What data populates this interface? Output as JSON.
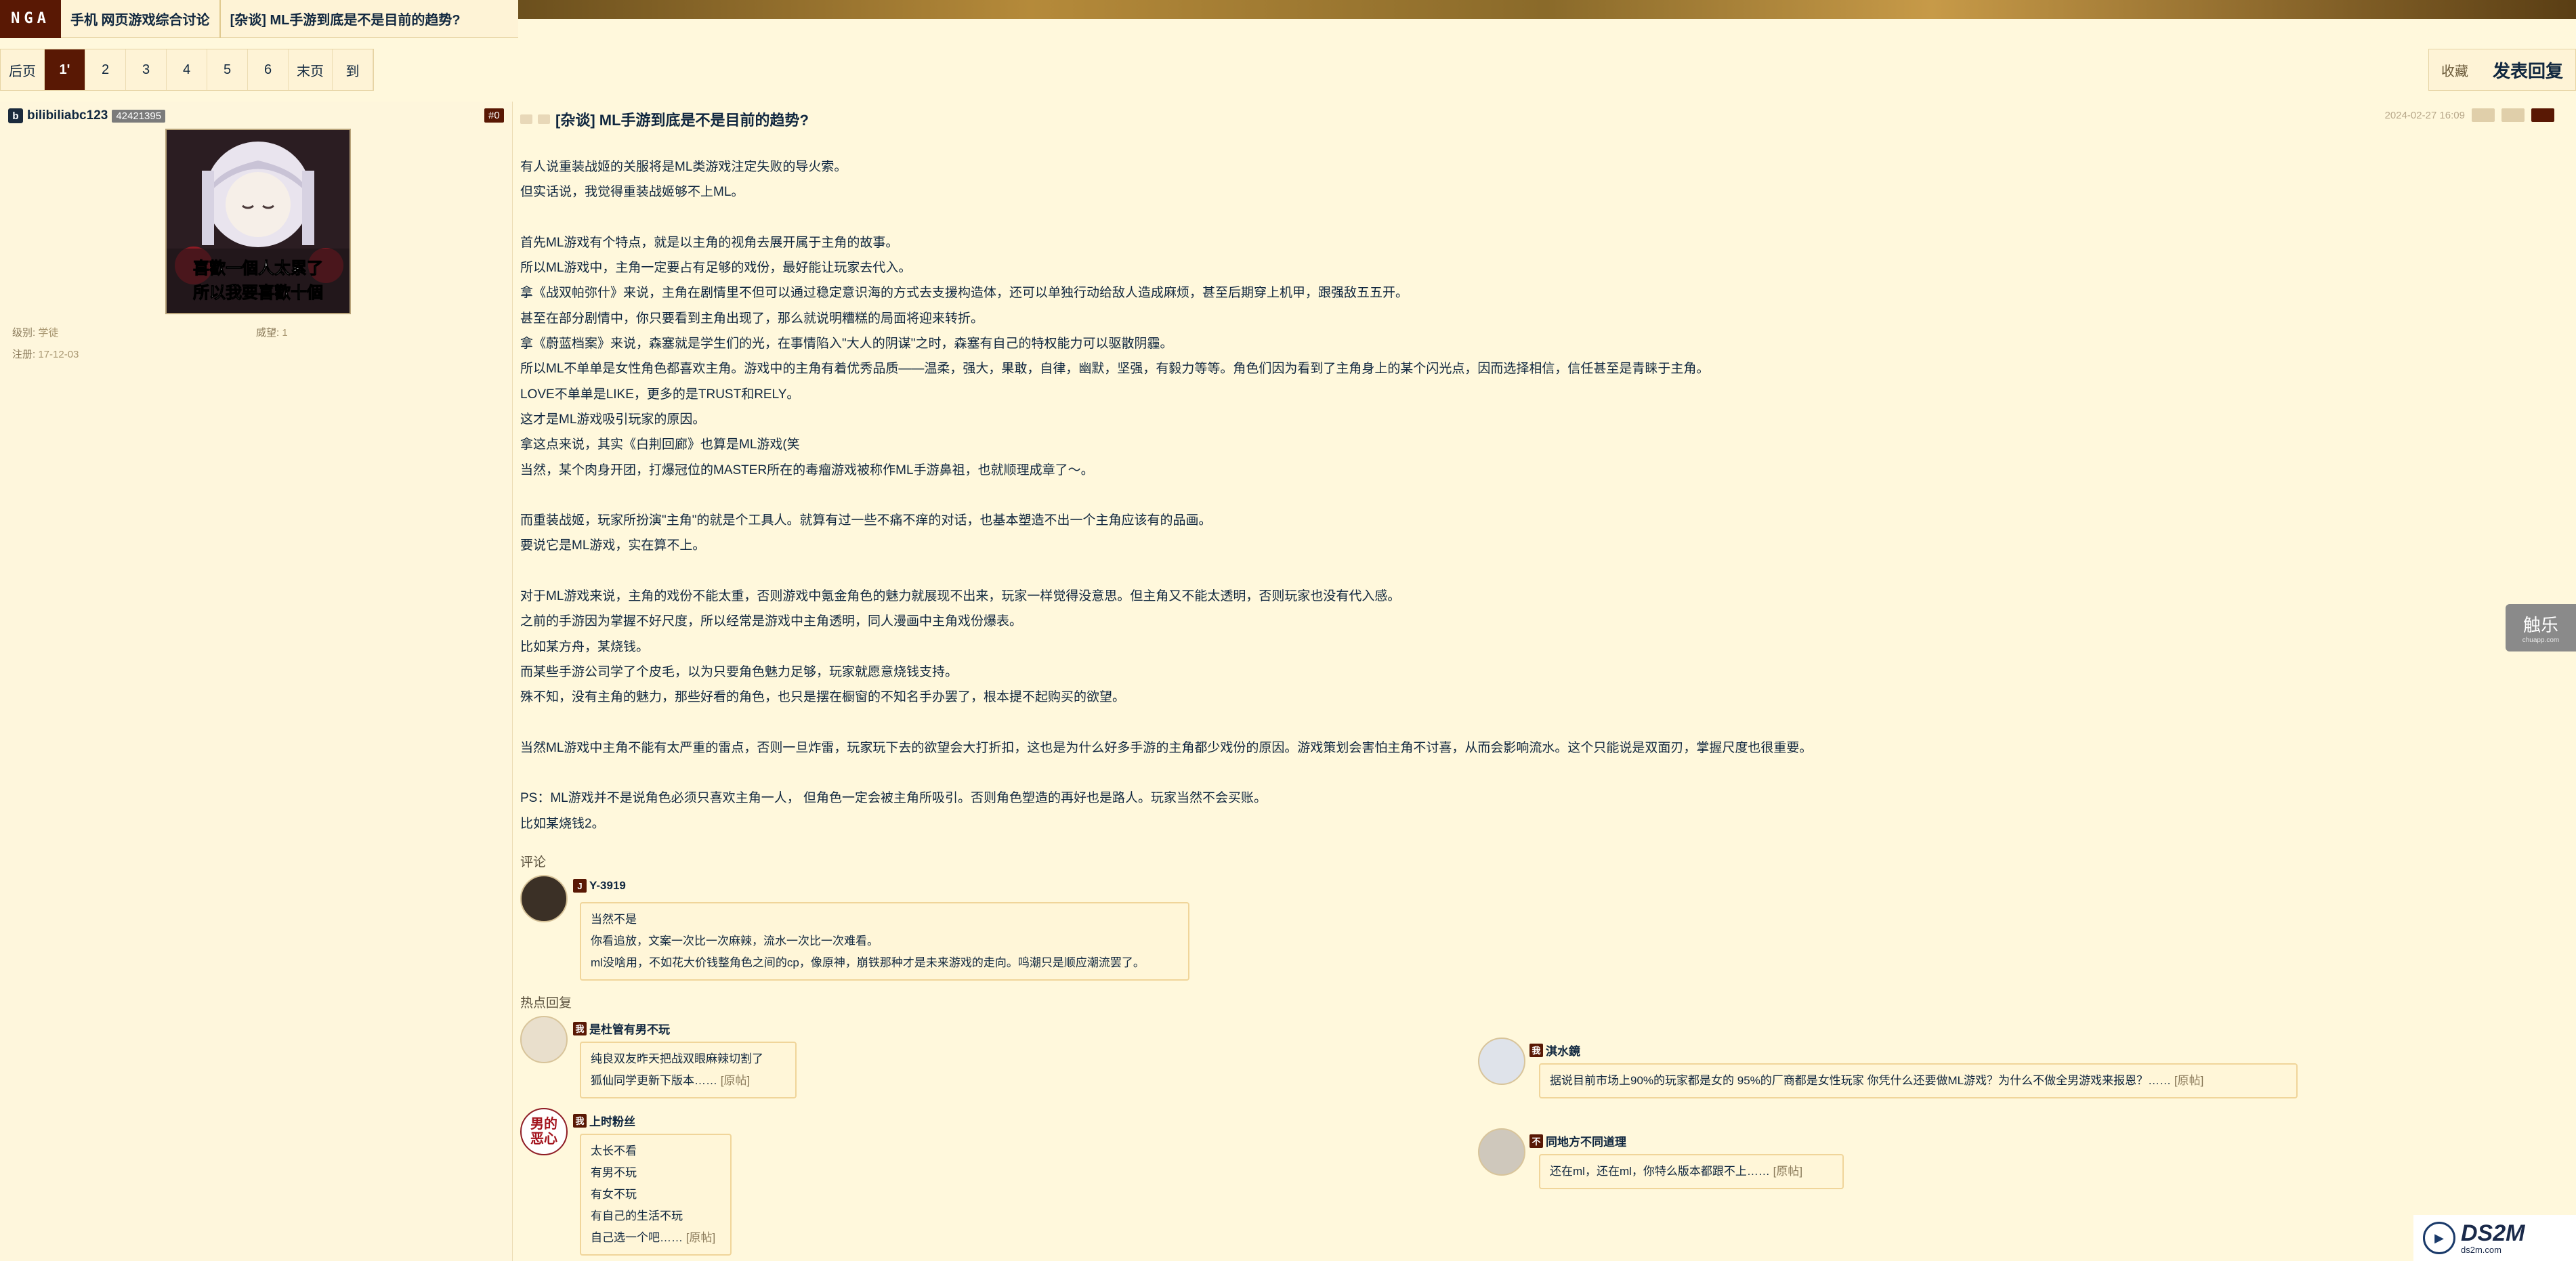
{
  "header": {
    "logo": "NGA",
    "crumbs": [
      "手机 网页游戏综合讨论",
      "[杂谈] ML手游到底是不是目前的趋势?"
    ]
  },
  "pager": {
    "items": [
      "后页",
      "1'",
      "2",
      "3",
      "4",
      "5",
      "6",
      "末页",
      "到"
    ],
    "active_index": 1
  },
  "actions": {
    "favorite": "收藏",
    "reply": "发表回复"
  },
  "user": {
    "name": "bilibiliabc123",
    "badge": "b",
    "uid": "42421395",
    "floor": "#0",
    "level_label": "级别:",
    "level": "学徒",
    "prestige_label": "威望:",
    "prestige": "1",
    "reg_label": "注册:",
    "reg": "17-12-03",
    "avatar_text_1": "喜歡一個人太累了",
    "avatar_text_2": "所以我要喜歡十個"
  },
  "post": {
    "title": "[杂谈] ML手游到底是不是目前的趋势?",
    "date": "2024-02-27 16:09",
    "lines": [
      "有人说重装战姬的关服将是ML类游戏注定失败的导火索。",
      "但实话说，我觉得重装战姬够不上ML。",
      "",
      "首先ML游戏有个特点，就是以主角的视角去展开属于主角的故事。",
      "所以ML游戏中，主角一定要占有足够的戏份，最好能让玩家去代入。",
      "拿《战双帕弥什》来说，主角在剧情里不但可以通过稳定意识海的方式去支援构造体，还可以单独行动给敌人造成麻烦，甚至后期穿上机甲，跟强敌五五开。",
      "甚至在部分剧情中，你只要看到主角出现了，那么就说明糟糕的局面将迎来转折。",
      "拿《蔚蓝档案》来说，森塞就是学生们的光，在事情陷入\"大人的阴谋\"之时，森塞有自己的特权能力可以驱散阴霾。",
      "所以ML不单单是女性角色都喜欢主角。游戏中的主角有着优秀品质——温柔，强大，果敢，自律，幽默，坚强，有毅力等等。角色们因为看到了主角身上的某个闪光点，因而选择相信，信任甚至是青睐于主角。",
      "LOVE不单单是LIKE，更多的是TRUST和RELY。",
      "这才是ML游戏吸引玩家的原因。",
      "拿这点来说，其实《白荆回廊》也算是ML游戏(笑",
      "当然，某个肉身开团，打爆冠位的MASTER所在的毒瘤游戏被称作ML手游鼻祖，也就顺理成章了～。",
      "",
      "而重装战姬，玩家所扮演\"主角\"的就是个工具人。就算有过一些不痛不痒的对话，也基本塑造不出一个主角应该有的品画。",
      "要说它是ML游戏，实在算不上。",
      "",
      "对于ML游戏来说，主角的戏份不能太重，否则游戏中氪金角色的魅力就展现不出来，玩家一样觉得没意思。但主角又不能太透明，否则玩家也没有代入感。",
      "之前的手游因为掌握不好尺度，所以经常是游戏中主角透明，同人漫画中主角戏份爆表。",
      "比如某方舟，某烧钱。",
      "而某些手游公司学了个皮毛，以为只要角色魅力足够，玩家就愿意烧钱支持。",
      "殊不知，没有主角的魅力，那些好看的角色，也只是摆在橱窗的不知名手办罢了，根本提不起购买的欲望。",
      "",
      "当然ML游戏中主角不能有太严重的雷点，否则一旦炸雷，玩家玩下去的欲望会大打折扣，这也是为什么好多手游的主角都少戏份的原因。游戏策划会害怕主角不讨喜，从而会影响流水。这个只能说是双面刃，掌握尺度也很重要。",
      "",
      "PS：ML游戏并不是说角色必须只喜欢主角一人，  但角色一定会被主角所吸引。否则角色塑造的再好也是路人。玩家当然不会买账。",
      "比如某烧钱2。"
    ]
  },
  "comments": {
    "label": "评论",
    "items": [
      {
        "name": "Y-3919",
        "tag": "J",
        "lines": [
          "当然不是",
          "你看追放，文案一次比一次麻辣，流水一次比一次难看。",
          "ml没啥用，不如花大价钱整角色之间的cp，像原神，崩铁那种才是未来游戏的走向。鸣潮只是顺应潮流罢了。"
        ]
      }
    ]
  },
  "hot": {
    "label": "热点回复",
    "source_label": "[原帖]",
    "left": [
      {
        "name": "是杜管有男不玩",
        "tag": "我",
        "lines": [
          "纯良双友昨天把战双眼麻辣切割了",
          "狐仙同学更新下版本……"
        ]
      },
      {
        "name": "上时粉丝",
        "tag": "我",
        "avatar_text_1": "男的",
        "avatar_text_2": "恶心",
        "lines": [
          "太长不看",
          "有男不玩",
          "有女不玩",
          "有自己的生活不玩",
          "自己选一个吧……"
        ]
      }
    ],
    "right": [
      {
        "name": "淇水鏡",
        "tag": "我",
        "lines": [
          "据说目前市场上90%的玩家都是女的 95%的厂商都是女性玩家 你凭什么还要做ML游戏？为什么不做全男游戏来报恩？……"
        ]
      },
      {
        "name": "同地方不同道理",
        "tag": "不",
        "lines": [
          "还在ml，还在ml，你特么版本都跟不上……"
        ]
      }
    ]
  },
  "side_ad": {
    "title": "触乐",
    "subtitle": "chuapp.com"
  },
  "watermark": {
    "brand": "DS2M",
    "url": "ds2m.com"
  },
  "colors": {
    "accent": "#591804",
    "background": "#fff8dc",
    "bubble_border": "#f0d59a"
  }
}
